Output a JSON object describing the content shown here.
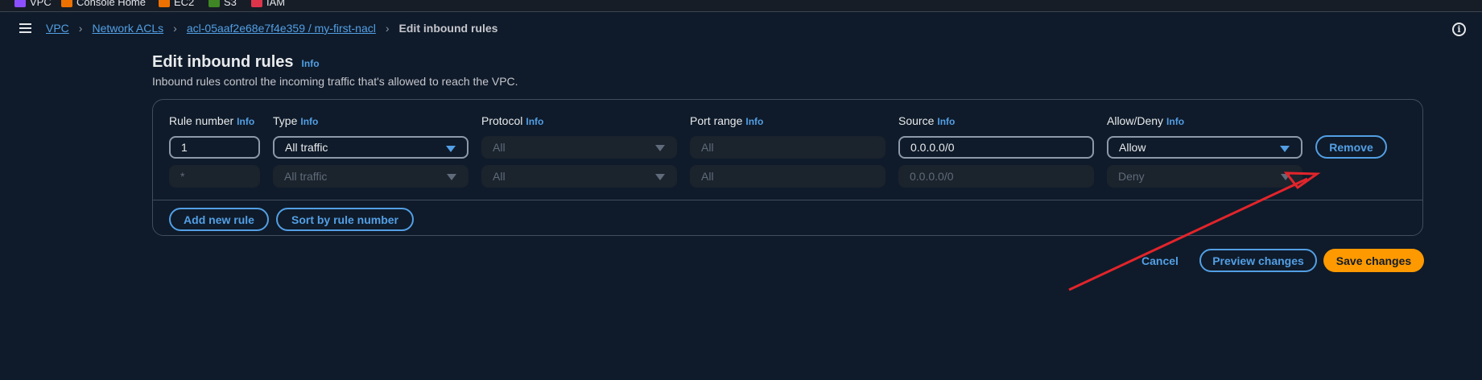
{
  "favorites": [
    {
      "label": "VPC",
      "color": "#8c4fff"
    },
    {
      "label": "Console Home",
      "color": "#ed7100"
    },
    {
      "label": "EC2",
      "color": "#ed7100"
    },
    {
      "label": "S3",
      "color": "#3f8624"
    },
    {
      "label": "IAM",
      "color": "#dd344c"
    }
  ],
  "breadcrumb": {
    "items": [
      "VPC",
      "Network ACLs",
      "acl-05aaf2e68e7f4e359 / my-first-nacl"
    ],
    "current": "Edit inbound rules"
  },
  "header": {
    "title": "Edit inbound rules",
    "info": "Info",
    "description": "Inbound rules control the incoming traffic that's allowed to reach the VPC."
  },
  "columns": {
    "rule_number": "Rule number",
    "type": "Type",
    "protocol": "Protocol",
    "port_range": "Port range",
    "source": "Source",
    "allow_deny": "Allow/Deny",
    "info": "Info"
  },
  "rule_row": {
    "rule_number": "1",
    "type": "All traffic",
    "protocol": "All",
    "port_range": "All",
    "source": "0.0.0.0/0",
    "allow_deny": "Allow",
    "remove_label": "Remove"
  },
  "default_row": {
    "rule_number": "*",
    "type": "All traffic",
    "protocol": "All",
    "port_range": "All",
    "source": "0.0.0.0/0",
    "allow_deny": "Deny"
  },
  "actions": {
    "add_rule": "Add new rule",
    "sort": "Sort by rule number",
    "cancel": "Cancel",
    "preview": "Preview changes",
    "save": "Save changes"
  },
  "colors": {
    "background": "#0f1b2a",
    "link": "#539fe5",
    "primary": "#ff9900",
    "annotation_arrow": "#e3242b"
  },
  "icons": [
    "menu-icon",
    "chevron-right-icon",
    "info-circle-icon",
    "caret-down-icon"
  ]
}
